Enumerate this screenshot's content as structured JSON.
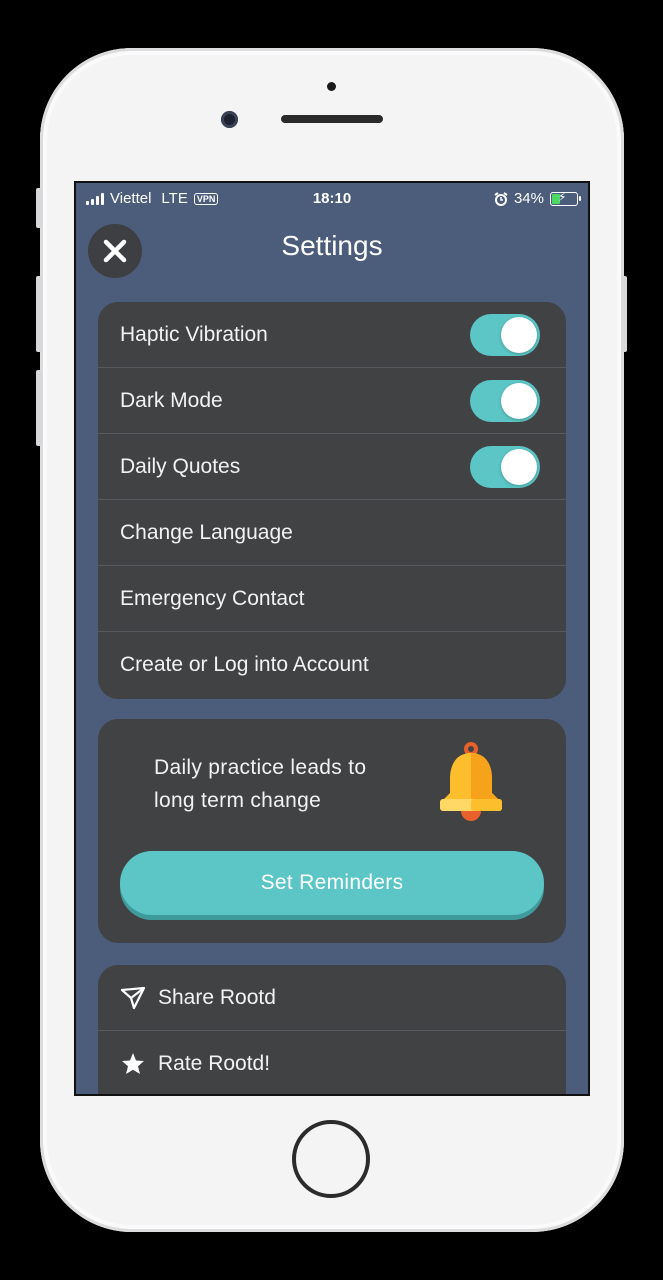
{
  "status_bar": {
    "carrier": "Viettel",
    "network": "LTE",
    "vpn": "VPN",
    "time": "18:10",
    "battery": "34%",
    "battery_level": 0.34
  },
  "header": {
    "title": "Settings",
    "close_icon": "close-icon"
  },
  "settings": {
    "items": [
      {
        "label": "Haptic Vibration",
        "toggle": true
      },
      {
        "label": "Dark Mode",
        "toggle": true
      },
      {
        "label": "Daily Quotes",
        "toggle": true
      },
      {
        "label": "Change Language"
      },
      {
        "label": "Emergency Contact"
      },
      {
        "label": "Create or Log into Account"
      }
    ]
  },
  "reminder": {
    "text_line1": "Daily practice leads to",
    "text_line2": "long term change",
    "icon": "bell-icon",
    "button_label": "Set Reminders"
  },
  "share": {
    "items": [
      {
        "label": "Share Rootd",
        "icon": "send-icon"
      },
      {
        "label": "Rate Rootd!",
        "icon": "star-icon"
      }
    ]
  },
  "colors": {
    "background": "#4b5d7b",
    "card": "#404244",
    "accent": "#5cc6c6"
  }
}
